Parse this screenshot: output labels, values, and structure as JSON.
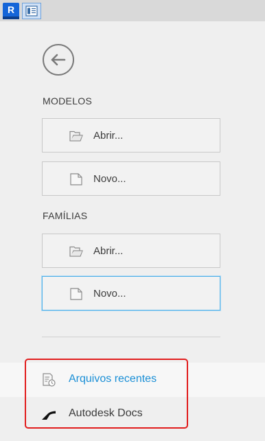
{
  "app": {
    "logo_letter": "R"
  },
  "sections": {
    "models": {
      "title": "MODELOS",
      "open_label": "Abrir...",
      "new_label": "Novo..."
    },
    "families": {
      "title": "FAMÍLIAS",
      "open_label": "Abrir...",
      "new_label": "Novo..."
    }
  },
  "nav": {
    "recent_label": "Arquivos recentes",
    "docs_label": "Autodesk Docs"
  },
  "colors": {
    "accent": "#1a8fd6",
    "highlight": "#e11c1c",
    "focus": "#54b2e8"
  }
}
